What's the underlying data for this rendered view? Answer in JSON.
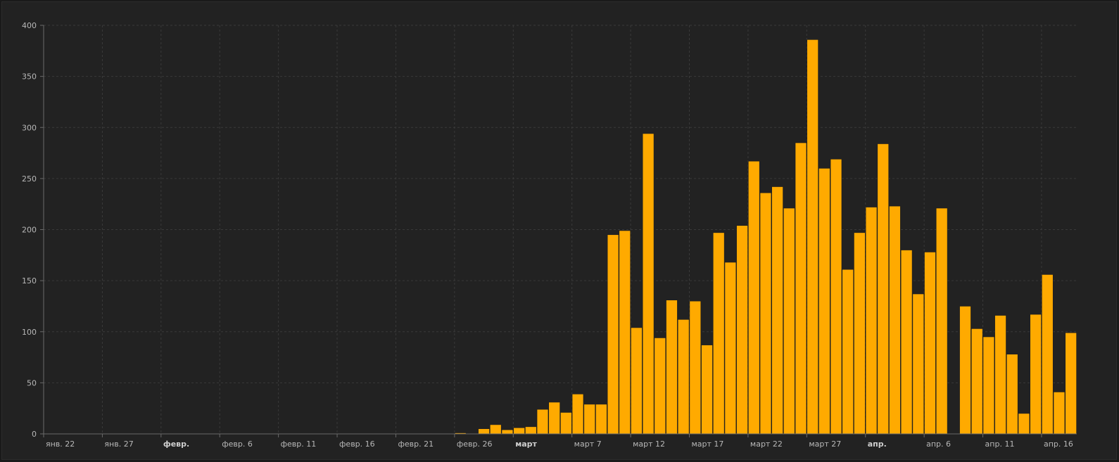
{
  "chart_data": {
    "type": "bar",
    "title": "",
    "xlabel": "",
    "ylabel": "",
    "ylim": [
      0,
      400
    ],
    "yticks": [
      0,
      50,
      100,
      150,
      200,
      250,
      300,
      350,
      400
    ],
    "grid": true,
    "legend": "none",
    "bar_color": "#ffaa00",
    "x_ticks": [
      {
        "label": "янв. 22",
        "index": 0,
        "bold": false
      },
      {
        "label": "янв. 27",
        "index": 5,
        "bold": false
      },
      {
        "label": "февр.",
        "index": 10,
        "bold": true
      },
      {
        "label": "февр. 6",
        "index": 15,
        "bold": false
      },
      {
        "label": "февр. 11",
        "index": 20,
        "bold": false
      },
      {
        "label": "февр. 16",
        "index": 25,
        "bold": false
      },
      {
        "label": "февр. 21",
        "index": 30,
        "bold": false
      },
      {
        "label": "февр. 26",
        "index": 35,
        "bold": false
      },
      {
        "label": "март",
        "index": 40,
        "bold": true
      },
      {
        "label": "март 7",
        "index": 45,
        "bold": false
      },
      {
        "label": "март 12",
        "index": 50,
        "bold": false
      },
      {
        "label": "март 17",
        "index": 55,
        "bold": false
      },
      {
        "label": "март 22",
        "index": 60,
        "bold": false
      },
      {
        "label": "март 27",
        "index": 65,
        "bold": false
      },
      {
        "label": "апр.",
        "index": 70,
        "bold": true
      },
      {
        "label": "апр. 6",
        "index": 75,
        "bold": false
      },
      {
        "label": "апр. 11",
        "index": 80,
        "bold": false
      },
      {
        "label": "апр. 16",
        "index": 85,
        "bold": false
      }
    ],
    "values": [
      0,
      0,
      0,
      0,
      0,
      0,
      0,
      0,
      0,
      0,
      0,
      0,
      0,
      0,
      0,
      0,
      0,
      0,
      0,
      0,
      0,
      0,
      0,
      0,
      0,
      0,
      0,
      0,
      0,
      0,
      0,
      0,
      0,
      0,
      0,
      1,
      0,
      5,
      9,
      4,
      6,
      7,
      24,
      31,
      21,
      39,
      29,
      29,
      195,
      199,
      104,
      294,
      94,
      131,
      112,
      130,
      87,
      197,
      168,
      204,
      267,
      236,
      242,
      221,
      285,
      386,
      260,
      269,
      161,
      197,
      222,
      284,
      223,
      180,
      137,
      178,
      221,
      0,
      125,
      103,
      95,
      116,
      78,
      20,
      117,
      156,
      41,
      99
    ]
  }
}
